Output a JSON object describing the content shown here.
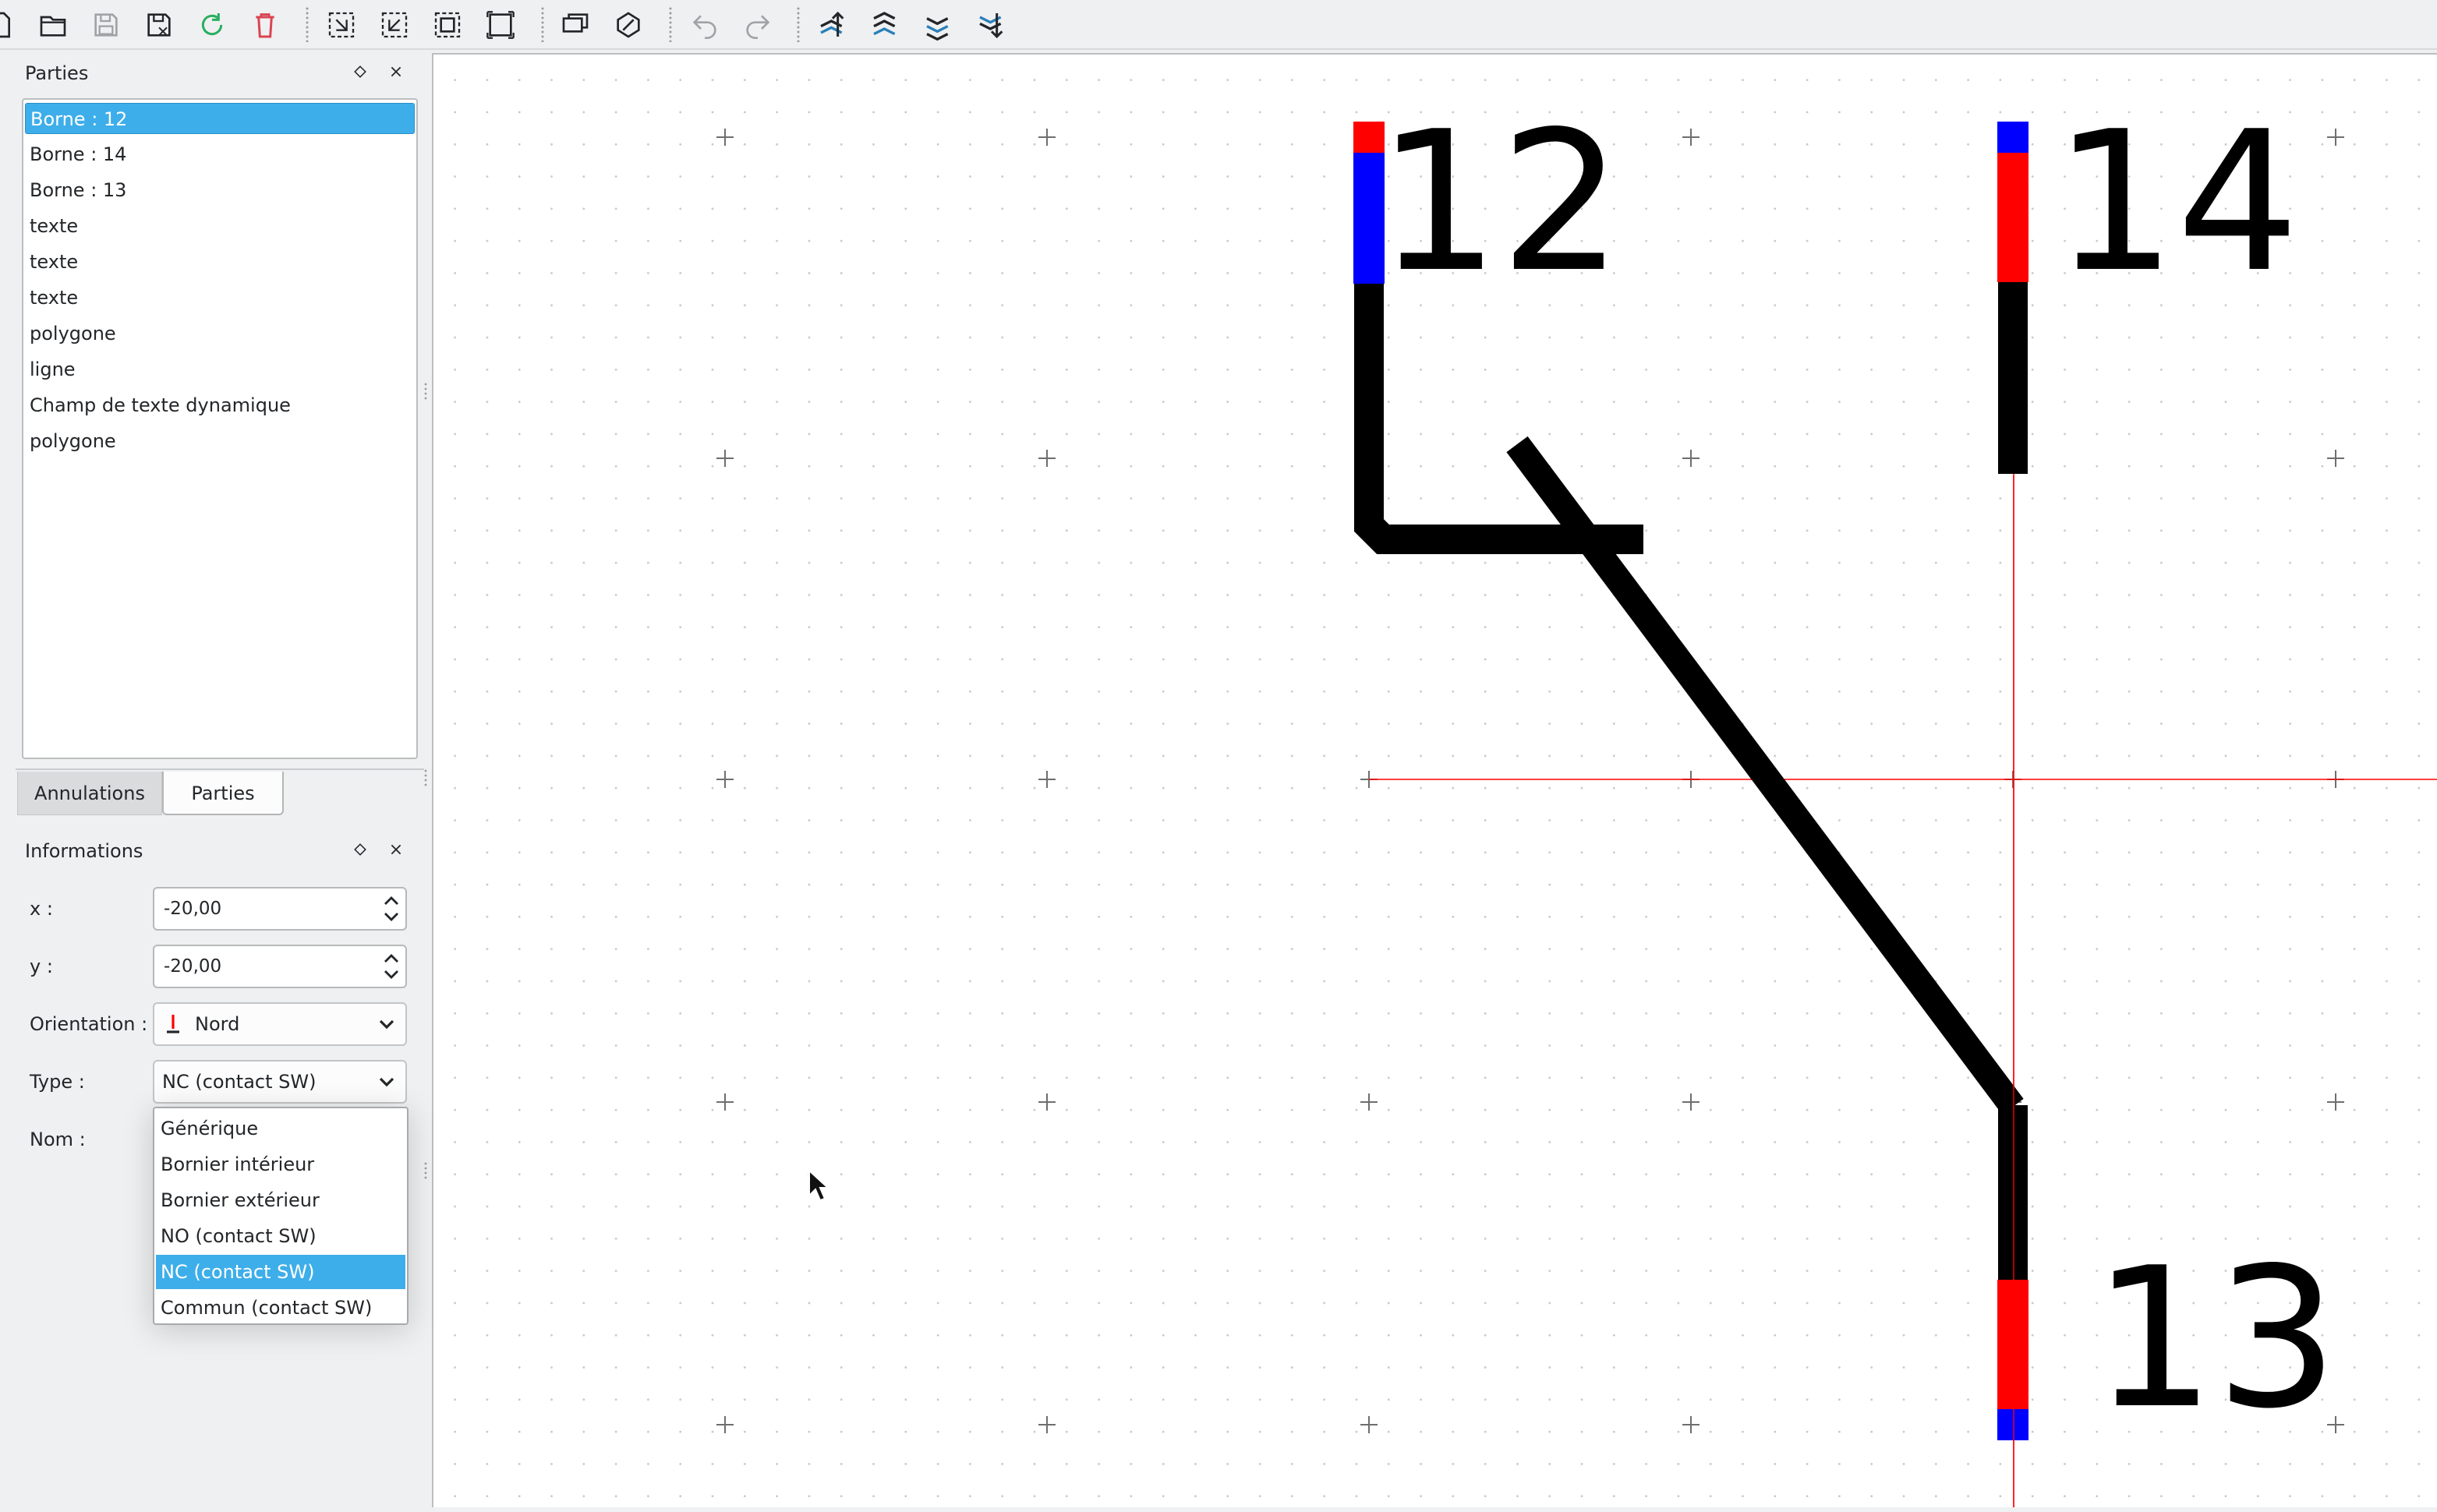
{
  "toolbar": {
    "buttons": [
      "new-icon",
      "open-icon",
      "save-icon",
      "save-as-icon",
      "reload-icon",
      "delete-icon",
      "select-all-icon",
      "deselect-icon",
      "invert-selection-icon",
      "fit-icon",
      "edit-info-icon",
      "edit-properties-icon",
      "undo-icon",
      "redo-icon",
      "bring-forward-icon",
      "raise-icon",
      "lower-icon",
      "send-backward-icon"
    ]
  },
  "parts_panel": {
    "title": "Parties",
    "items": [
      "Borne : 12",
      "Borne : 14",
      "Borne : 13",
      "texte",
      "texte",
      "texte",
      "polygone",
      "ligne",
      "Champ de texte dynamique",
      "polygone"
    ],
    "selected_index": 0
  },
  "tabs": {
    "undo_tab": "Annulations",
    "parts_tab": "Parties",
    "active": "Parties"
  },
  "info_panel": {
    "title": "Informations",
    "x_label": "x :",
    "x_value": "-20,00",
    "y_label": "y :",
    "y_value": "-20,00",
    "orientation_label": "Orientation :",
    "orientation_value": "Nord",
    "type_label": "Type :",
    "type_value": "NC (contact SW)",
    "name_label": "Nom :"
  },
  "type_dropdown": {
    "options": [
      "Générique",
      "Bornier intérieur",
      "Bornier extérieur",
      "NO (contact SW)",
      "NC (contact SW)",
      "Commun (contact SW)"
    ],
    "selected_index": 4
  },
  "canvas": {
    "terminal_labels": [
      "12",
      "14",
      "13"
    ],
    "colors": {
      "terminal_red": "#ff0000",
      "terminal_blue": "#0000ff",
      "axis_red": "#ff0000",
      "wire": "#000000"
    }
  }
}
